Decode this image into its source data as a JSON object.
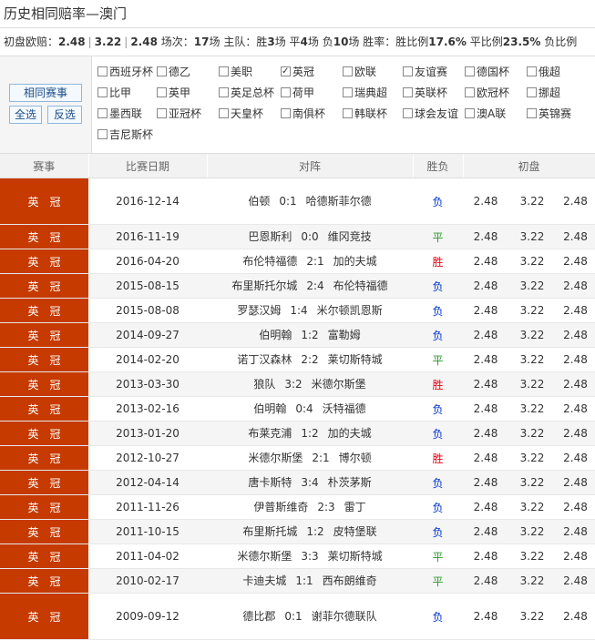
{
  "title": "历史相同赔率—澳门",
  "summary": {
    "label": "初盘欧赔：",
    "odds1": "2.48",
    "odds2": "3.22",
    "odds3": "2.48",
    "matches_label": "场次：",
    "matches": "17",
    "matches_unit": "场",
    "home_label": "主队：胜",
    "wins": "3",
    "wins_unit": "场 平",
    "draws": "4",
    "draws_unit": "场 负",
    "losses": "10",
    "losses_unit": "场",
    "rate_label": "胜率：胜比例",
    "win_pct": "17.6%",
    "draw_pct_label": "平比例",
    "draw_pct": "23.5%",
    "loss_pct_label": "负比例"
  },
  "buttons": {
    "same_match": "相同赛事",
    "select_all": "全选",
    "invert": "反选"
  },
  "leagues": [
    {
      "label": "西班牙杯",
      "checked": false
    },
    {
      "label": "德乙",
      "checked": false
    },
    {
      "label": "美职",
      "checked": false
    },
    {
      "label": "英冠",
      "checked": true
    },
    {
      "label": "欧联",
      "checked": false
    },
    {
      "label": "友谊赛",
      "checked": false
    },
    {
      "label": "德国杯",
      "checked": false
    },
    {
      "label": "俄超",
      "checked": false
    },
    {
      "label": "比甲",
      "checked": false
    },
    {
      "label": "英甲",
      "checked": false
    },
    {
      "label": "英足总杯",
      "checked": false
    },
    {
      "label": "荷甲",
      "checked": false
    },
    {
      "label": "瑞典超",
      "checked": false
    },
    {
      "label": "英联杯",
      "checked": false
    },
    {
      "label": "欧冠杯",
      "checked": false
    },
    {
      "label": "挪超",
      "checked": false
    },
    {
      "label": "墨西联",
      "checked": false
    },
    {
      "label": "亚冠杯",
      "checked": false
    },
    {
      "label": "天皇杯",
      "checked": false
    },
    {
      "label": "南俱杯",
      "checked": false
    },
    {
      "label": "韩联杯",
      "checked": false
    },
    {
      "label": "球会友谊",
      "checked": false
    },
    {
      "label": "澳A联",
      "checked": false
    },
    {
      "label": "英锦赛",
      "checked": false
    },
    {
      "label": "吉尼斯杯",
      "checked": false
    }
  ],
  "table": {
    "headers": [
      "赛事",
      "比赛日期",
      "对阵",
      "胜负",
      "初盘"
    ],
    "rows": [
      {
        "league": "英冠",
        "date": "2016-12-14",
        "home": "伯顿",
        "score": "0:1",
        "away": "哈德斯菲尔德",
        "result": "负",
        "o1": "2.48",
        "o2": "3.22",
        "o3": "2.48"
      },
      {
        "league": "英冠",
        "date": "2016-11-19",
        "home": "巴恩斯利",
        "score": "0:0",
        "away": "维冈竞技",
        "result": "平",
        "o1": "2.48",
        "o2": "3.22",
        "o3": "2.48"
      },
      {
        "league": "英冠",
        "date": "2016-04-20",
        "home": "布伦特福德",
        "score": "2:1",
        "away": "加的夫城",
        "result": "胜",
        "o1": "2.48",
        "o2": "3.22",
        "o3": "2.48"
      },
      {
        "league": "英冠",
        "date": "2015-08-15",
        "home": "布里斯托尔城",
        "score": "2:4",
        "away": "布伦特福德",
        "result": "负",
        "o1": "2.48",
        "o2": "3.22",
        "o3": "2.48"
      },
      {
        "league": "英冠",
        "date": "2015-08-08",
        "home": "罗瑟汉姆",
        "score": "1:4",
        "away": "米尔顿凯恩斯",
        "result": "负",
        "o1": "2.48",
        "o2": "3.22",
        "o3": "2.48"
      },
      {
        "league": "英冠",
        "date": "2014-09-27",
        "home": "伯明翰",
        "score": "1:2",
        "away": "富勒姆",
        "result": "负",
        "o1": "2.48",
        "o2": "3.22",
        "o3": "2.48"
      },
      {
        "league": "英冠",
        "date": "2014-02-20",
        "home": "诺丁汉森林",
        "score": "2:2",
        "away": "莱切斯特城",
        "result": "平",
        "o1": "2.48",
        "o2": "3.22",
        "o3": "2.48"
      },
      {
        "league": "英冠",
        "date": "2013-03-30",
        "home": "狼队",
        "score": "3:2",
        "away": "米德尔斯堡",
        "result": "胜",
        "o1": "2.48",
        "o2": "3.22",
        "o3": "2.48"
      },
      {
        "league": "英冠",
        "date": "2013-02-16",
        "home": "伯明翰",
        "score": "0:4",
        "away": "沃特福德",
        "result": "负",
        "o1": "2.48",
        "o2": "3.22",
        "o3": "2.48"
      },
      {
        "league": "英冠",
        "date": "2013-01-20",
        "home": "布莱克浦",
        "score": "1:2",
        "away": "加的夫城",
        "result": "负",
        "o1": "2.48",
        "o2": "3.22",
        "o3": "2.48"
      },
      {
        "league": "英冠",
        "date": "2012-10-27",
        "home": "米德尔斯堡",
        "score": "2:1",
        "away": "博尔顿",
        "result": "胜",
        "o1": "2.48",
        "o2": "3.22",
        "o3": "2.48"
      },
      {
        "league": "英冠",
        "date": "2012-04-14",
        "home": "唐卡斯特",
        "score": "3:4",
        "away": "朴茨茅斯",
        "result": "负",
        "o1": "2.48",
        "o2": "3.22",
        "o3": "2.48"
      },
      {
        "league": "英冠",
        "date": "2011-11-26",
        "home": "伊普斯维奇",
        "score": "2:3",
        "away": "雷丁",
        "result": "负",
        "o1": "2.48",
        "o2": "3.22",
        "o3": "2.48"
      },
      {
        "league": "英冠",
        "date": "2011-10-15",
        "home": "布里斯托城",
        "score": "1:2",
        "away": "皮特堡联",
        "result": "负",
        "o1": "2.48",
        "o2": "3.22",
        "o3": "2.48"
      },
      {
        "league": "英冠",
        "date": "2011-04-02",
        "home": "米德尔斯堡",
        "score": "3:3",
        "away": "莱切斯特城",
        "result": "平",
        "o1": "2.48",
        "o2": "3.22",
        "o3": "2.48"
      },
      {
        "league": "英冠",
        "date": "2010-02-17",
        "home": "卡迪夫城",
        "score": "1:1",
        "away": "西布朗维奇",
        "result": "平",
        "o1": "2.48",
        "o2": "3.22",
        "o3": "2.48"
      },
      {
        "league": "英冠",
        "date": "2009-09-12",
        "home": "德比郡",
        "score": "0:1",
        "away": "谢菲尔德联队",
        "result": "负",
        "o1": "2.48",
        "o2": "3.22",
        "o3": "2.48"
      }
    ]
  }
}
